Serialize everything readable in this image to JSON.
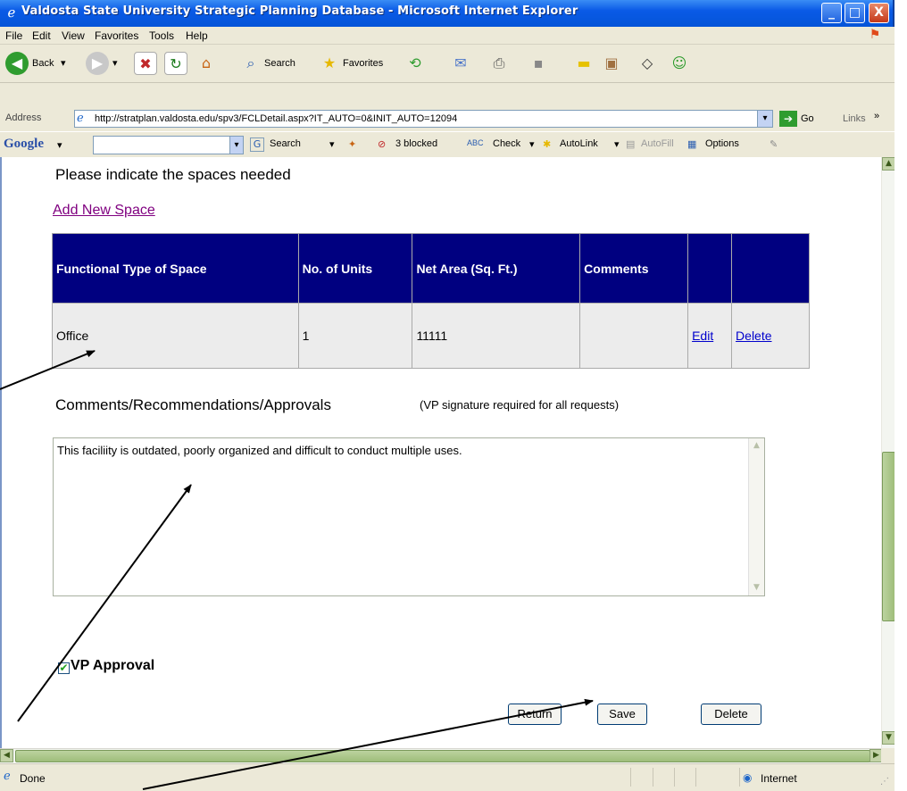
{
  "window": {
    "title": "Valdosta State University Strategic Planning Database - Microsoft Internet Explorer",
    "min_label": "_",
    "max_label": "□",
    "close_label": "X"
  },
  "menu": [
    "File",
    "Edit",
    "View",
    "Favorites",
    "Tools",
    "Help"
  ],
  "toolbar": {
    "back_label": "Back",
    "search_label": "Search",
    "favorites_label": "Favorites"
  },
  "address": {
    "label": "Address",
    "url": "http://stratplan.valdosta.edu/spv3/FCLDetail.aspx?IT_AUTO=0&INIT_AUTO=12094",
    "go_label": "Go",
    "links_label": "Links"
  },
  "google_bar": {
    "logo": "Google",
    "search_label": "Search",
    "blocked_label": "3 blocked",
    "check_label": "Check",
    "autolink_label": "AutoLink",
    "autofill_label": "AutoFill",
    "options_label": "Options"
  },
  "page": {
    "heading": "Please indicate the spaces needed",
    "add_link": "Add New Space",
    "table": {
      "headers": [
        "Functional Type of Space",
        "No. of Units",
        "Net Area (Sq. Ft.)",
        "Comments",
        "",
        ""
      ],
      "rows": [
        {
          "type": "Office",
          "units": "1",
          "area": "11111",
          "comments": "",
          "edit_label": "Edit",
          "delete_label": "Delete"
        }
      ]
    },
    "comments_heading": "Comments/Recommendations/Approvals",
    "vp_note": "(VP signature required for all requests)",
    "comments_value": "This faciliity is outdated, poorly organized and difficult to conduct multiple uses.",
    "vp_approval_label": "VP Approval",
    "vp_approval_checked": true,
    "return_label": "Return",
    "save_label": "Save",
    "delete_label": "Delete"
  },
  "status": {
    "text": "Done",
    "zone": "Internet"
  },
  "colors": {
    "title_bar": "#0a5ae6",
    "table_header": "#000080",
    "visited_link": "#800080",
    "link": "#0000cc"
  }
}
